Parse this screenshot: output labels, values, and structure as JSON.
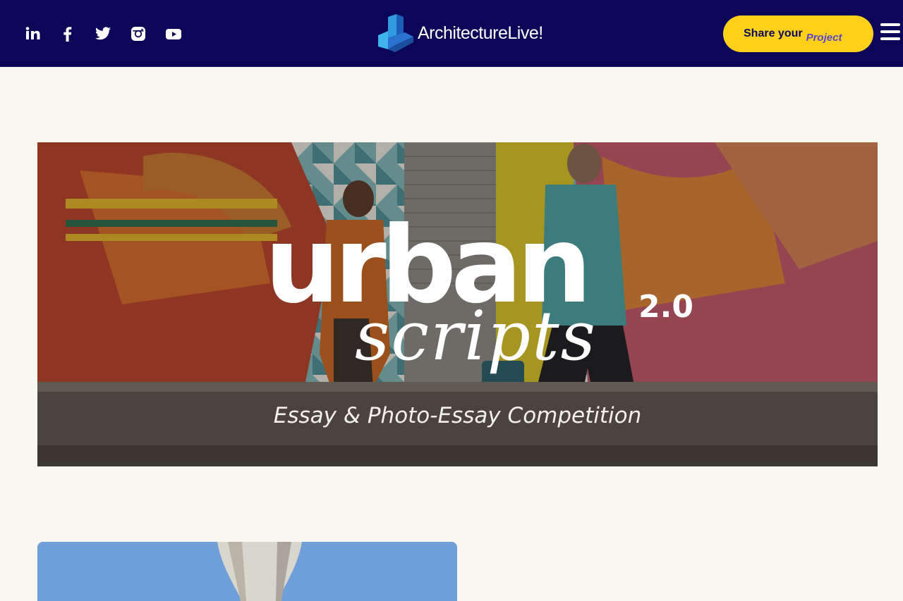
{
  "header": {
    "social_icons": [
      "linkedin-icon",
      "facebook-icon",
      "twitter-icon",
      "instagram-icon",
      "youtube-icon"
    ],
    "logo_text": "ArchitectureLive!",
    "share_button": {
      "part1": "Share your",
      "part2": "Project"
    },
    "menu_icon": "hamburger-menu-icon"
  },
  "banner": {
    "title_line1": "urban",
    "title_line2": "scripts",
    "version": "2.0",
    "subtitle": "Essay & Photo-Essay Competition"
  },
  "colors": {
    "header_bg": "#0b0657",
    "accent_yellow": "#ffd01a",
    "page_bg": "#f8f7f0",
    "logo_blue": "#2f7fd6"
  }
}
